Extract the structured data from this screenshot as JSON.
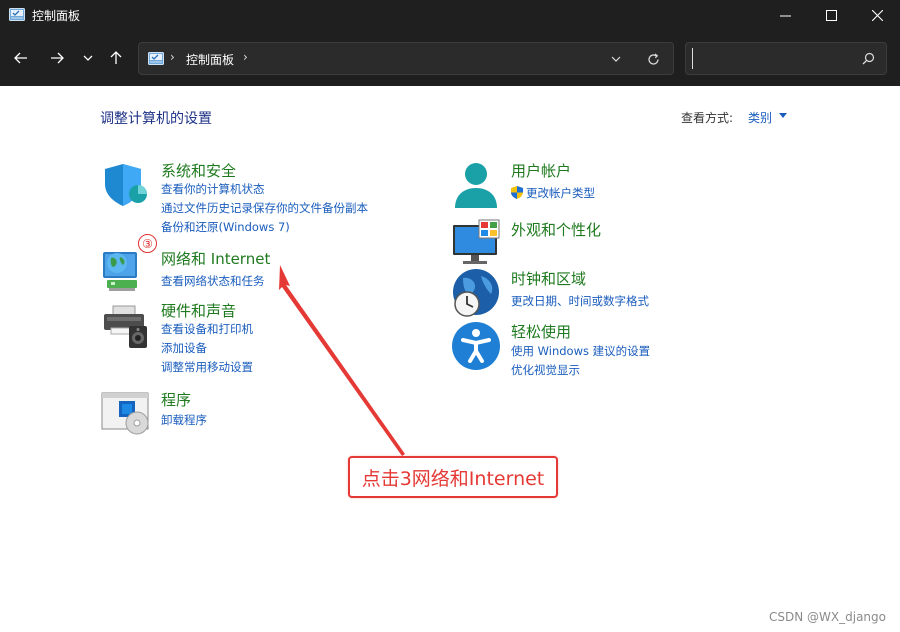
{
  "window": {
    "title": "控制面板"
  },
  "navigation": {
    "address": {
      "crumbs": [
        "控制面板"
      ],
      "separator": "›"
    },
    "search": {
      "placeholder": ""
    }
  },
  "main": {
    "title": "调整计算机的设置",
    "view_by_label": "查看方式:",
    "view_by_value": "类别"
  },
  "categories_left": [
    {
      "head": "系统和安全",
      "links": [
        "查看你的计算机状态",
        "通过文件历史记录保存你的文件备份副本",
        "备份和还原(Windows 7)"
      ]
    },
    {
      "head": "网络和 Internet",
      "links": [
        "查看网络状态和任务"
      ]
    },
    {
      "head": "硬件和声音",
      "links": [
        "查看设备和打印机",
        "添加设备",
        "调整常用移动设置"
      ]
    },
    {
      "head": "程序",
      "links": [
        "卸载程序"
      ]
    }
  ],
  "categories_right": [
    {
      "head": "用户帐户",
      "links": [
        "更改帐户类型"
      ]
    },
    {
      "head": "外观和个性化",
      "links": []
    },
    {
      "head": "时钟和区域",
      "links": [
        "更改日期、时间或数字格式"
      ]
    },
    {
      "head": "轻松使用",
      "links": [
        "使用 Windows 建议的设置",
        "优化视觉显示"
      ]
    }
  ],
  "annotation": {
    "badge": "③",
    "callout": "点击3网络和Internet",
    "color": "#e53935"
  },
  "watermark": "CSDN @WX_django",
  "colors": {
    "heading": "#1f7a1f",
    "link": "#1a5dbd",
    "title": "#1e3287",
    "chrome": "#1f1f1f"
  }
}
